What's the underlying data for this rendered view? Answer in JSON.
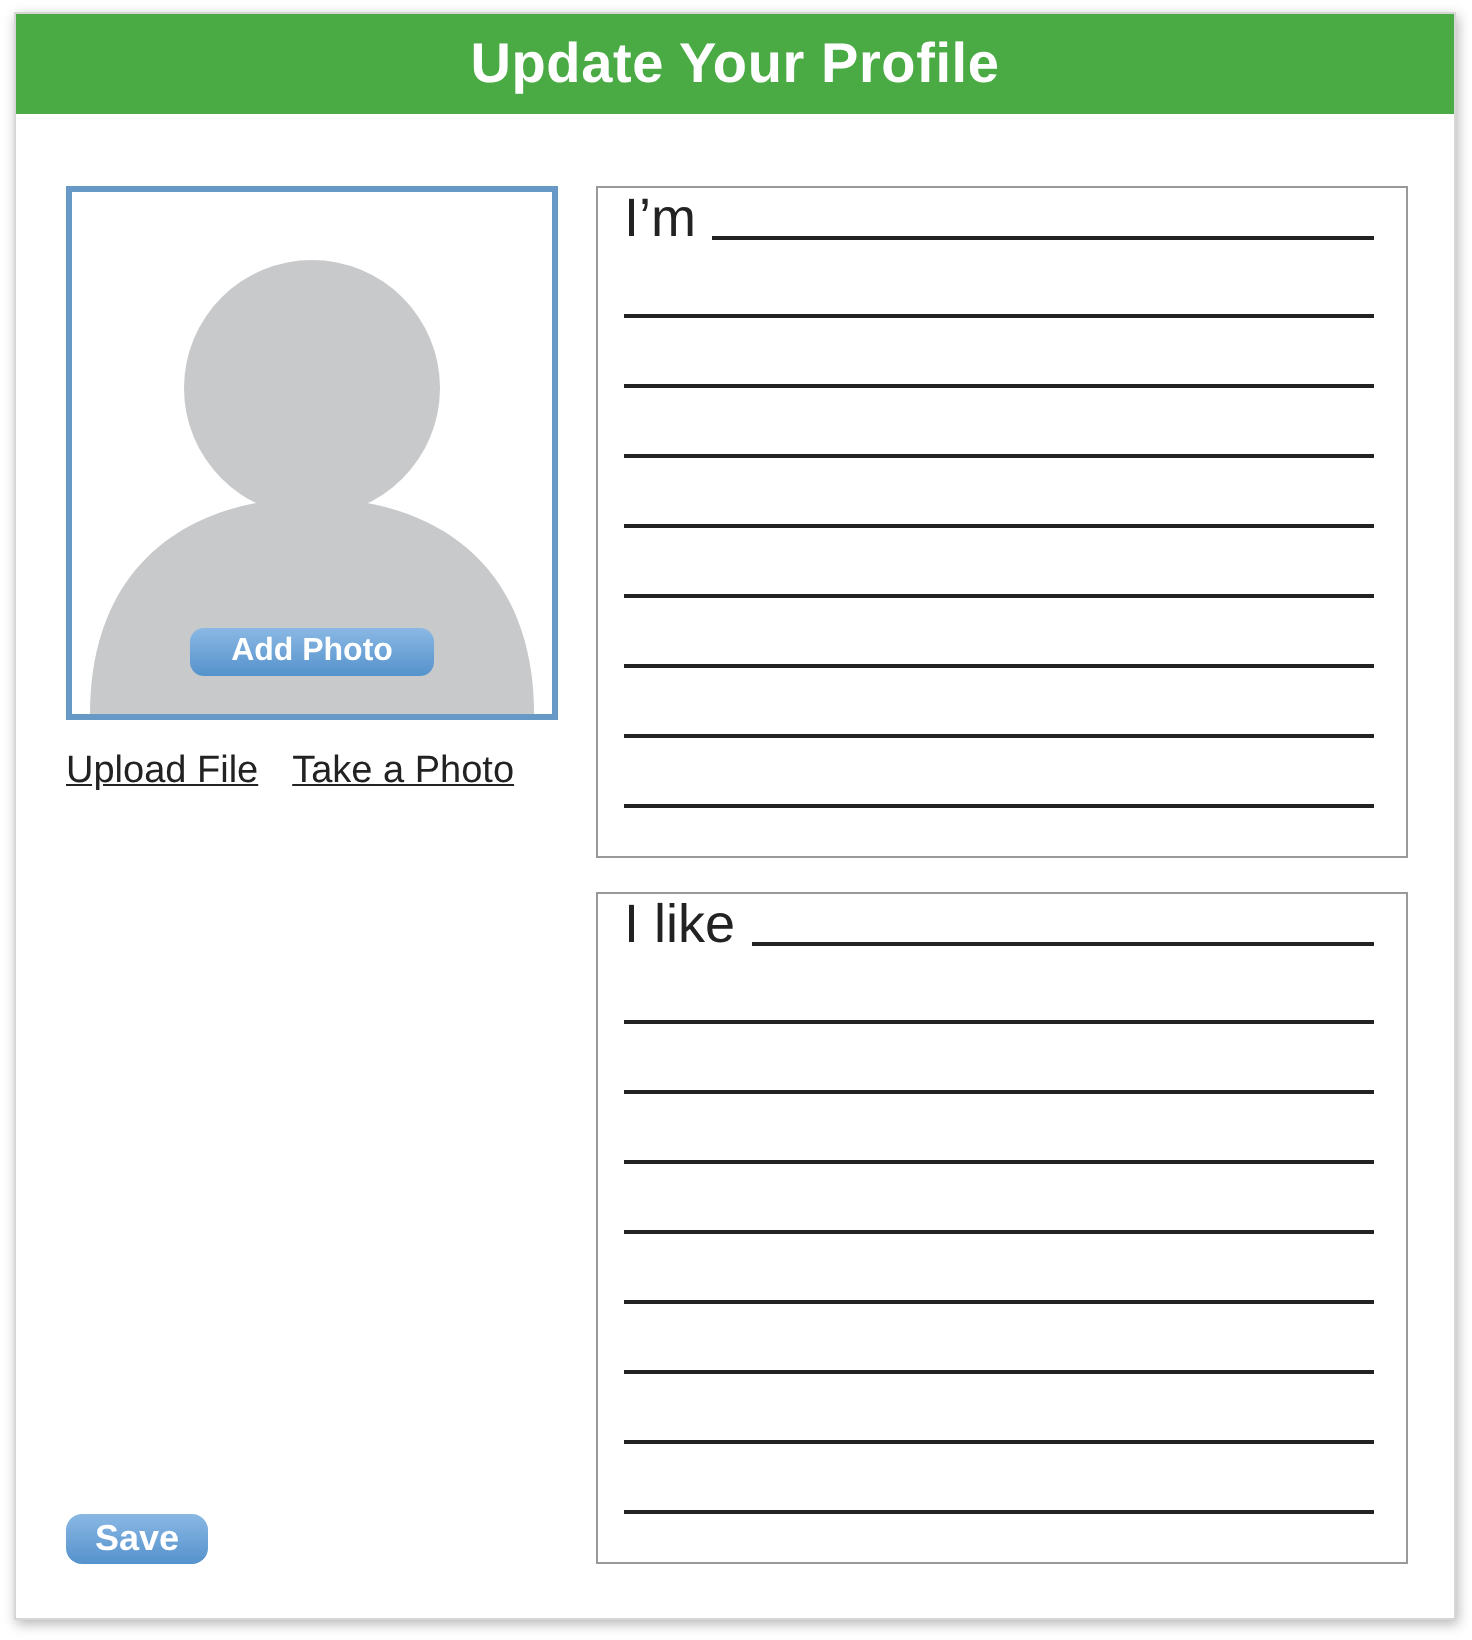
{
  "header": {
    "title": "Update Your Profile"
  },
  "photo": {
    "button": "Add Photo"
  },
  "links": [
    "Upload File",
    "Take a Photo"
  ],
  "sections": [
    {
      "prompt": "I’m"
    },
    {
      "prompt": "I like"
    }
  ],
  "save_button": "Save"
}
